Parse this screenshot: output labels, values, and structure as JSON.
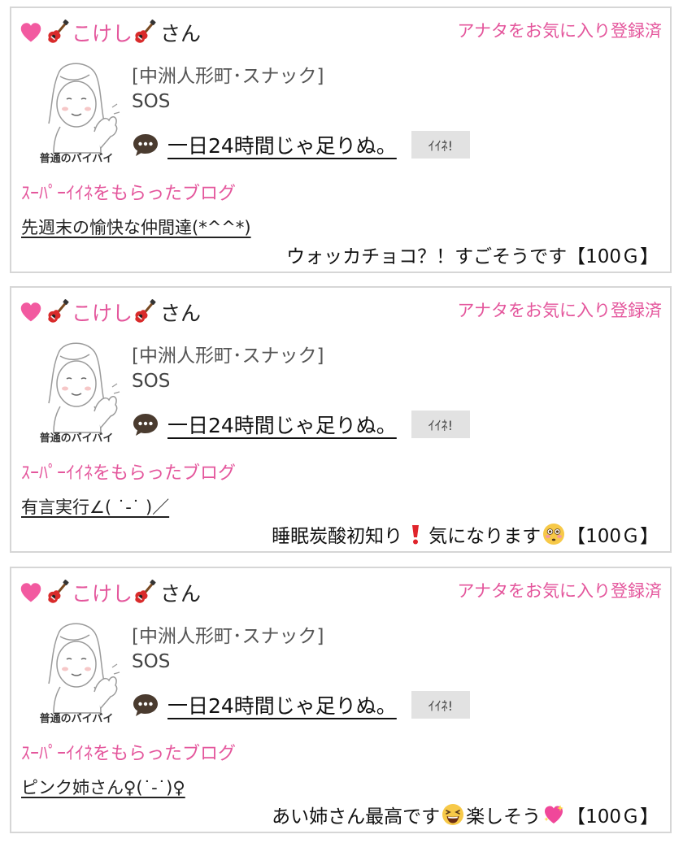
{
  "cards": [
    {
      "user_name": "こけし",
      "user_suffix": "さん",
      "favorite_status": "アナタをお気に入り登録済",
      "avatar_caption": "普通のバイバイ",
      "avatar_side_text": "ばいばい",
      "shop": "[中洲人形町･スナック]",
      "owner": "SOS",
      "message": "一日24時間じゃ足りぬ。",
      "like_label": "ｲｲﾈ!",
      "super_label": "ｽｰﾊﾟｰｲｲﾈをもらったブログ",
      "blog_title": "先週末の愉快な仲間達(*^^*)",
      "comment_parts": [
        "ウォッカチョコ？！すごそうです",
        "",
        "",
        ""
      ],
      "reward": "【100Ｇ】"
    },
    {
      "user_name": "こけし",
      "user_suffix": "さん",
      "favorite_status": "アナタをお気に入り登録済",
      "avatar_caption": "普通のバイバイ",
      "avatar_side_text": "ばいばい",
      "shop": "[中洲人形町･スナック]",
      "owner": "SOS",
      "message": "一日24時間じゃ足りぬ。",
      "like_label": "ｲｲﾈ!",
      "super_label": "ｽｰﾊﾟｰｲｲﾈをもらったブログ",
      "blog_title": "有言実行∠(   ˙-˙ )／",
      "comment_parts": [
        "睡眠炭酸初知り",
        "気になります",
        "",
        ""
      ],
      "reward": "【100Ｇ】"
    },
    {
      "user_name": "こけし",
      "user_suffix": "さん",
      "favorite_status": "アナタをお気に入り登録済",
      "avatar_caption": "普通のバイバイ",
      "avatar_side_text": "ばいばい",
      "shop": "[中洲人形町･スナック]",
      "owner": "SOS",
      "message": "一日24時間じゃ足りぬ。",
      "like_label": "ｲｲﾈ!",
      "super_label": "ｽｰﾊﾟｰｲｲﾈをもらったブログ",
      "blog_title": "ピンク姉さん♀(˙-˙)♀",
      "comment_parts": [
        "あい姉さん最高です",
        "楽しそう",
        "",
        ""
      ],
      "reward": "【100Ｇ】"
    }
  ],
  "icons": {
    "heart": "heart-icon",
    "guitar": "guitar-icon",
    "chat": "speech-bubble-icon",
    "exclamation": "red-exclamation-icon",
    "flushed": "flushed-face-icon",
    "laughing": "laughing-face-icon",
    "sparkling_heart": "sparkling-heart-icon"
  },
  "colors": {
    "pink": "#e4569c",
    "border": "#d6d6d6",
    "like_bg": "#e2e2e2"
  }
}
